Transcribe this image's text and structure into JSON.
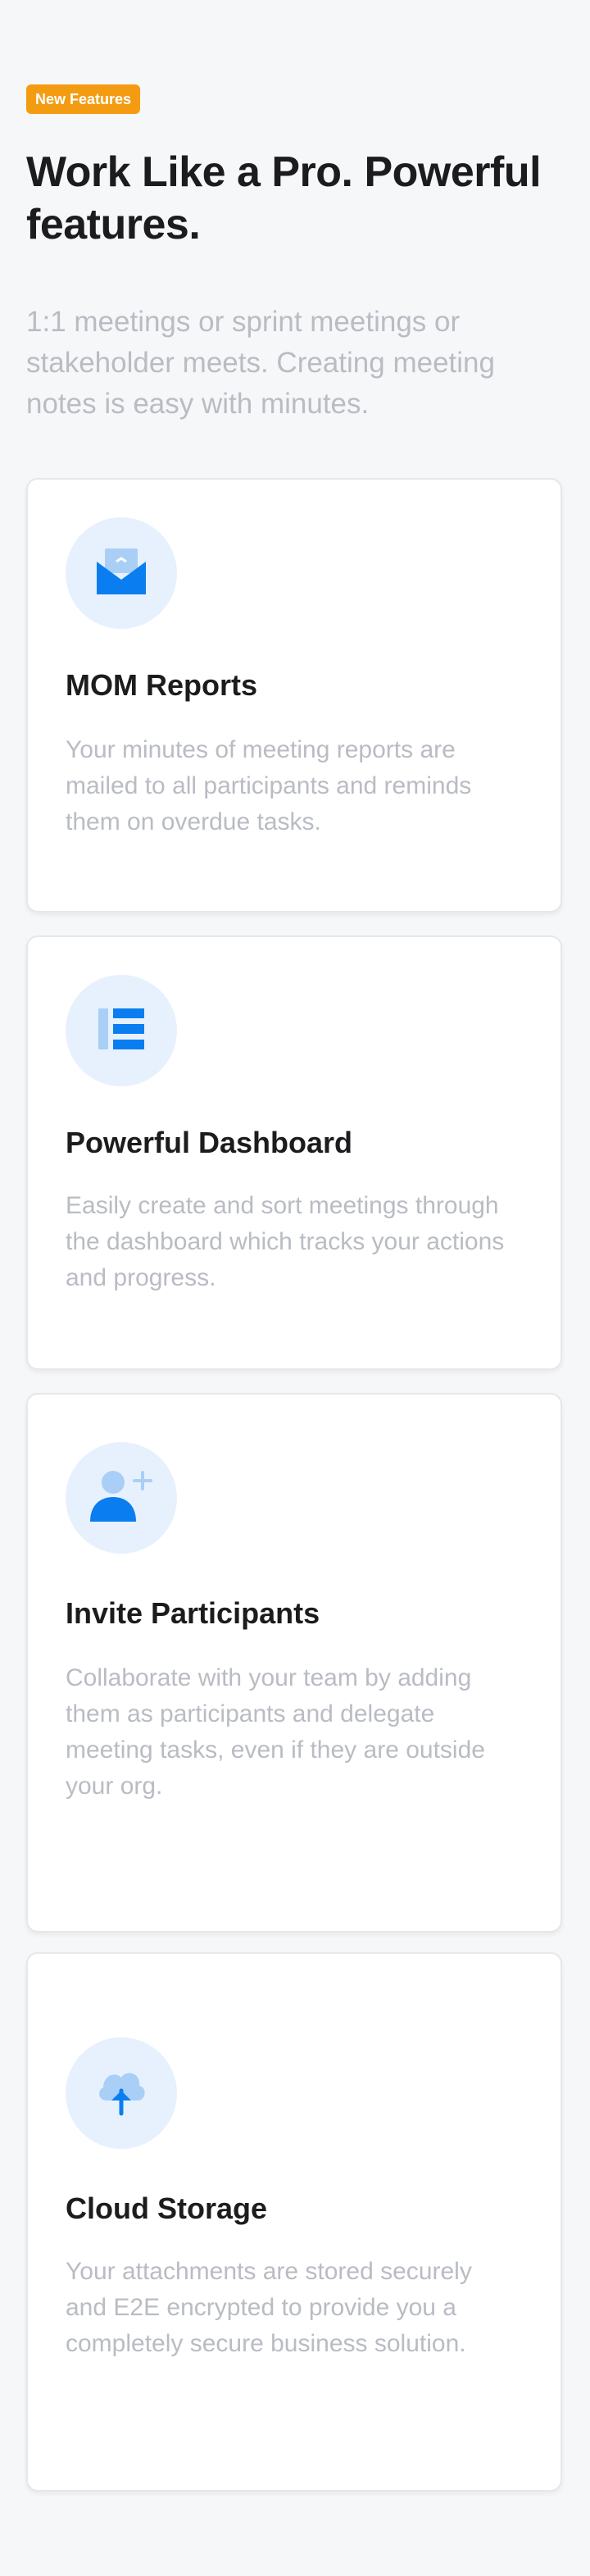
{
  "badge": "New Features",
  "headline": "Work Like a Pro. Powerful features.",
  "subtitle": "1:1 meetings or sprint meetings or stakeholder meets. Creating meeting notes is easy with minutes.",
  "features": [
    {
      "icon": "mail-icon",
      "title": "MOM Reports",
      "description": "Your minutes of meeting reports are mailed to all participants and reminds them on overdue tasks."
    },
    {
      "icon": "dashboard-icon",
      "title": "Powerful Dashboard",
      "description": "Easily create and sort meetings through the dashboard which tracks your actions and progress."
    },
    {
      "icon": "add-user-icon",
      "title": "Invite Participants",
      "description": "Collaborate with your team by adding them as participants and delegate meeting tasks, even if they are outside your org."
    },
    {
      "icon": "cloud-upload-icon",
      "title": "Cloud Storage",
      "description": "Your attachments are stored securely and E2E encrypted to provide you a completely secure business solution."
    }
  ],
  "colors": {
    "accent": "#0a7ef0",
    "accent_light": "#a9cff6",
    "icon_bg": "#e7f1fd",
    "badge": "#f39c12",
    "muted_text": "#b9bcc3"
  }
}
